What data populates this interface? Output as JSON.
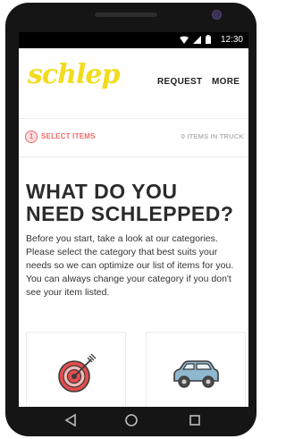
{
  "status_bar": {
    "time": "12:30",
    "icons": [
      "wifi-icon",
      "signal-icon",
      "battery-icon"
    ]
  },
  "app": {
    "logo": "schlep",
    "logo_color": "#f2dc1c",
    "nav": {
      "request": "REQUEST",
      "more": "MORE"
    }
  },
  "progress": {
    "step_number": "1",
    "step_label": "SELECT ITEMS",
    "truck_count": "0 ITEMS IN TRUCK",
    "accent": "#ef6b6b"
  },
  "main": {
    "title": "WHAT DO YOU NEED SCHLEPPED?",
    "intro": "Before you start, take a look at our categories. Please select the category that best suits your needs so we can optimize our list of items for you. You can always change your category if you don't see your item listed."
  },
  "categories": [
    {
      "icon": "target-icon"
    },
    {
      "icon": "car-icon"
    }
  ],
  "system_nav": [
    "back-icon",
    "home-icon",
    "recents-icon"
  ]
}
